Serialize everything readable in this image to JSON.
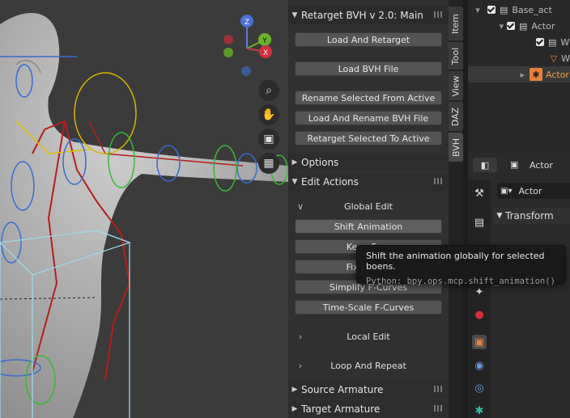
{
  "viewport": {
    "gizmo": {
      "z": "Z",
      "y": "Y",
      "x": "X"
    },
    "nav_icons": [
      "zoom-icon",
      "hand-icon",
      "camera-icon",
      "grid-icon"
    ]
  },
  "panel": {
    "retarget": {
      "title": "Retarget BVH v 2.0: Main",
      "buttons": [
        "Load And Retarget",
        "Load BVH File",
        "Rename Selected From Active",
        "Load And Rename BVH File",
        "Retarget Selected To Active"
      ]
    },
    "options": {
      "title": "Options"
    },
    "edit_actions": {
      "title": "Edit Actions",
      "global_edit": "Global Edit",
      "buttons": [
        "Shift Animation",
        "Keep Fe…",
        "Fixate B…",
        "Simplify F-Curves",
        "Time-Scale F-Curves"
      ],
      "local_edit": "Local Edit",
      "loop_repeat": "Loop And Repeat"
    },
    "source_armature": {
      "title": "Source Armature"
    },
    "target_armature": {
      "title": "Target Armature"
    }
  },
  "tabs": [
    "Item",
    "Tool",
    "View",
    "DAZ",
    "BVH"
  ],
  "outliner": {
    "rows": [
      "Base_act",
      "Actor",
      "W",
      "W",
      "Actor"
    ]
  },
  "properties": {
    "object_name": "Actor",
    "data_name": "Actor",
    "transform": "Transform"
  },
  "tooltip": {
    "text": "Shift the animation globally for selected boens.",
    "python": "Python: bpy.ops.mcp.shift_animation()"
  },
  "colors": {
    "accent": "#e8823a",
    "selection": "#d8a028",
    "tooltip_bg": "#191919"
  }
}
